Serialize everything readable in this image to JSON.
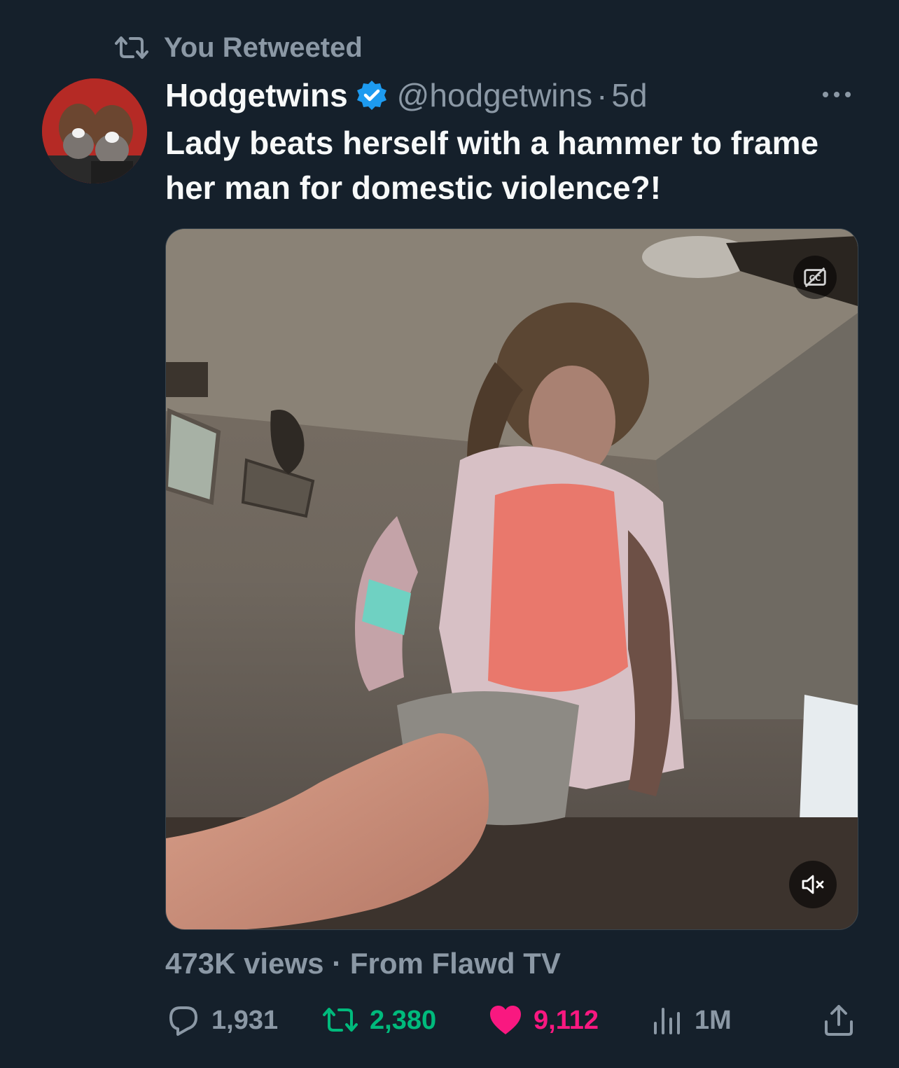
{
  "retweet_banner": {
    "label": "You Retweeted"
  },
  "author": {
    "name": "Hodgetwins",
    "handle": "@hodgetwins",
    "separator": "·",
    "time": "5d"
  },
  "tweet": {
    "text": "Lady beats herself with a hammer to frame her man for domestic violence?!"
  },
  "media": {
    "type": "video",
    "captions_icon": "captions-off-icon",
    "mute_icon": "volume-muted-icon"
  },
  "meta": {
    "views": "473K views",
    "separator": "·",
    "source": "From Flawd TV"
  },
  "actions": {
    "reply": {
      "icon": "reply-icon",
      "count": "1,931"
    },
    "retweet": {
      "icon": "retweet-icon",
      "count": "2,380",
      "active_color": "#00ba7c"
    },
    "like": {
      "icon": "heart-icon",
      "count": "9,112",
      "active_color": "#f91880"
    },
    "views": {
      "icon": "analytics-icon",
      "count": "1M"
    },
    "share": {
      "icon": "share-icon"
    }
  },
  "colors": {
    "background": "#15202b",
    "text_primary": "#f7f9f9",
    "text_secondary": "#8b98a5",
    "verified": "#1d9bf0"
  }
}
